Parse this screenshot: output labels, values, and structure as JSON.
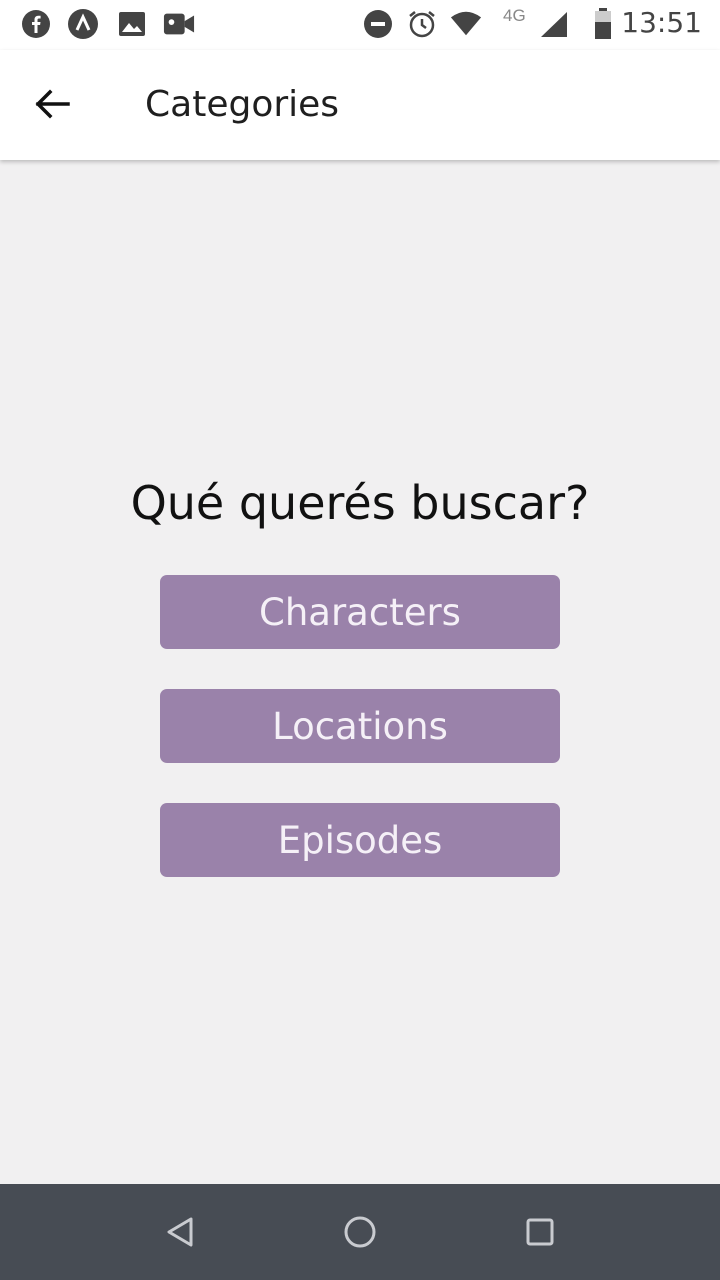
{
  "status_bar": {
    "time": "13:51",
    "network": "4G",
    "icons": [
      "facebook-icon",
      "app-a-icon",
      "image-icon",
      "video-icon",
      "dnd-icon",
      "alarm-icon",
      "wifi-icon",
      "signal-icon",
      "battery-icon"
    ]
  },
  "app_bar": {
    "title": "Categories",
    "back_icon": "arrow-left-icon"
  },
  "main": {
    "question": "Qué querés buscar?",
    "buttons": [
      {
        "label": "Characters"
      },
      {
        "label": "Locations"
      },
      {
        "label": "Episodes"
      }
    ],
    "button_color": "#9a82aa"
  },
  "nav_bar": {
    "icons": [
      "back-triangle-icon",
      "home-circle-icon",
      "recents-square-icon"
    ]
  }
}
